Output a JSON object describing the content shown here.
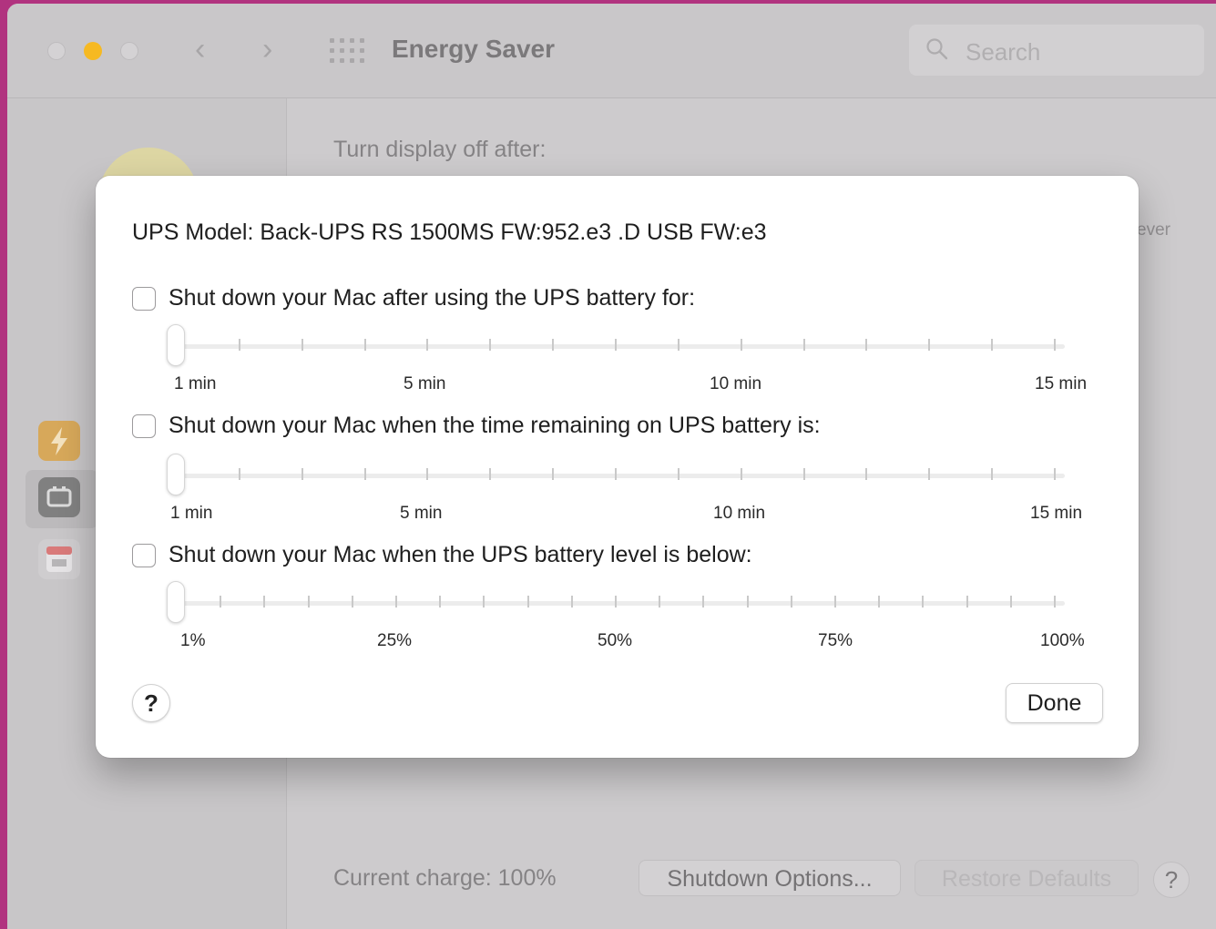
{
  "window": {
    "title": "Energy Saver",
    "search_placeholder": "Search",
    "nav_back": "‹",
    "nav_forward": "›"
  },
  "background": {
    "display_off_label": "Turn display off after:",
    "never_fragment": "ever",
    "current_charge": "Current charge: 100%",
    "shutdown_options_button": "Shutdown Options...",
    "restore_defaults_button": "Restore Defaults",
    "help_button": "?"
  },
  "sheet": {
    "ups_model": "UPS Model: Back-UPS RS 1500MS FW:952.e3 .D USB FW:e3",
    "options": [
      {
        "label": "Shut down your Mac after using the UPS battery for:",
        "checked": false,
        "slider_value_fraction": 0,
        "tick_count": 15,
        "tick_labels": [
          "1 min",
          "5 min",
          "10 min",
          "15 min"
        ]
      },
      {
        "label": "Shut down your Mac when the time remaining on UPS battery is:",
        "checked": false,
        "slider_value_fraction": 0,
        "tick_count": 15,
        "tick_labels": [
          "1 min",
          "5 min",
          "10 min",
          "15 min"
        ]
      },
      {
        "label": "Shut down your Mac when the UPS battery level is below:",
        "checked": false,
        "slider_value_fraction": 0,
        "tick_count": 21,
        "tick_labels": [
          "1%",
          "25%",
          "50%",
          "75%",
          "100%"
        ]
      }
    ],
    "help_button": "?",
    "done_button": "Done"
  },
  "colors": {
    "accent_minimize": "#f6b922",
    "desktop": "#b1337f"
  }
}
